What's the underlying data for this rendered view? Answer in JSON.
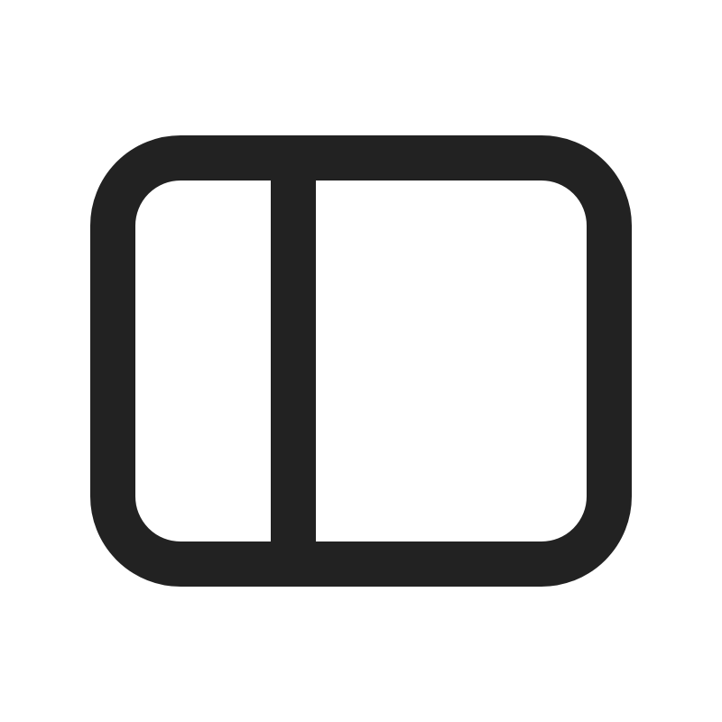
{
  "icon": {
    "name": "sidebar-panel-left-icon",
    "color": "#222222",
    "background": "#ffffff"
  }
}
